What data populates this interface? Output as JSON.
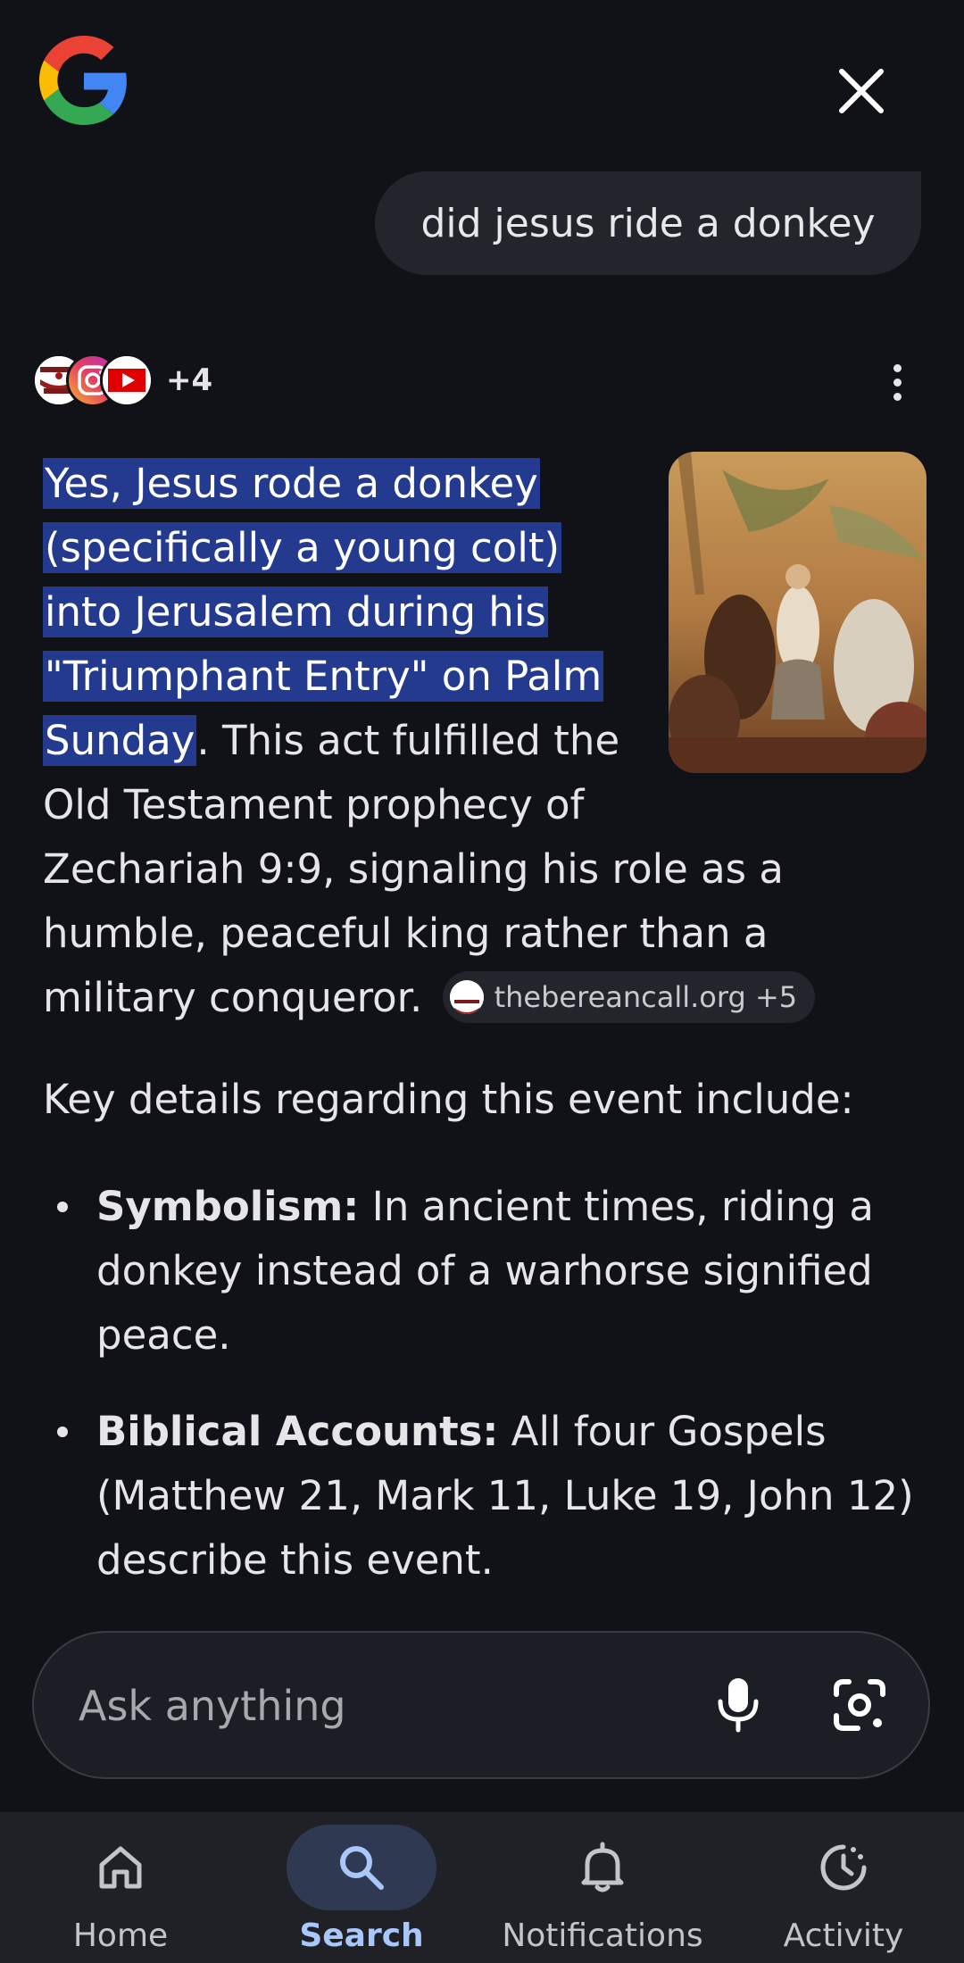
{
  "header": {
    "logo_icon": "google-g-icon",
    "close_icon": "close-icon"
  },
  "query": {
    "text": "did jesus ride a donkey"
  },
  "sources": {
    "icons": [
      "thebereancall-icon",
      "instagram-icon",
      "youtube-icon"
    ],
    "more_count": "+4"
  },
  "answer": {
    "highlight_lines": [
      "Yes, Jesus rode a donkey",
      "(specifically a young colt)",
      "into Jerusalem during his",
      "\"Triumphant Entry\" on Palm",
      "Sunday"
    ],
    "rest": ". This act fulfilled the Old Testament prophecy of Zechariah 9:9, signaling his role as a humble, peaceful king rather than a military conqueror.",
    "citation": "thebereancall.org +5",
    "image_alt": "Painting of Jesus entering Jerusalem on a donkey"
  },
  "details": {
    "intro": "Key details regarding this event include:",
    "items": [
      {
        "term": "Symbolism:",
        "text": " In ancient times, riding a donkey instead of a warhorse signified peace."
      },
      {
        "term": "Biblical Accounts:",
        "text": " All four Gospels (Matthew 21, Mark 11, Luke 19, John 12) describe this event."
      }
    ]
  },
  "ask_bar": {
    "placeholder": "Ask anything",
    "mic_icon": "microphone-icon",
    "lens_icon": "google-lens-icon"
  },
  "nav": {
    "items": [
      {
        "label": "Home",
        "icon": "home-icon",
        "active": false
      },
      {
        "label": "Search",
        "icon": "search-icon",
        "active": true
      },
      {
        "label": "Notifications",
        "icon": "bell-icon",
        "active": false
      },
      {
        "label": "Activity",
        "icon": "activity-icon",
        "active": false
      }
    ]
  },
  "colors": {
    "background": "#101218",
    "highlight": "#233a8f",
    "nav_active": "#a8c7fa",
    "nav_active_pill": "#2f3a52"
  }
}
